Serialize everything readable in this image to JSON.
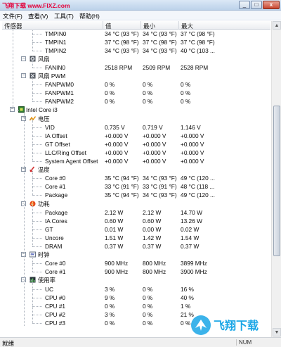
{
  "window": {
    "title": "飞翔下载 www.FIXZ.com"
  },
  "menu": [
    "文件(F)",
    "查看(V)",
    "工具(T)",
    "帮助(H)"
  ],
  "columns": {
    "sensor": "传感器",
    "value": "值",
    "min": "最小",
    "max": "最大"
  },
  "tree": [
    {
      "kind": "leaf",
      "label": "TMPIN0",
      "vals": [
        "34 °C  (93 °F)",
        "34 °C  (93 °F)",
        "37 °C  (98 °F)"
      ]
    },
    {
      "kind": "leaf",
      "label": "TMPIN1",
      "vals": [
        "37 °C  (98 °F)",
        "37 °C  (98 °F)",
        "37 °C  (98 °F)"
      ]
    },
    {
      "kind": "leaf",
      "label": "TMPIN2",
      "vals": [
        "34 °C  (93 °F)",
        "34 °C  (93 °F)",
        "40 °C  (103 ..."
      ]
    },
    {
      "kind": "cat",
      "label": "风扇",
      "icon": "fan-icon"
    },
    {
      "kind": "leaf",
      "label": "FANIN0",
      "vals": [
        "2518 RPM",
        "2509 RPM",
        "2528 RPM"
      ]
    },
    {
      "kind": "cat",
      "label": "风扇 PWM",
      "icon": "fan-pwm-icon"
    },
    {
      "kind": "leaf",
      "label": "FANPWM0",
      "vals": [
        "0 %",
        "0 %",
        "0 %"
      ]
    },
    {
      "kind": "leaf",
      "label": "FANPWM1",
      "vals": [
        "0 %",
        "0 %",
        "0 %"
      ]
    },
    {
      "kind": "leaf",
      "label": "FANPWM2",
      "vals": [
        "0 %",
        "0 %",
        "0 %"
      ]
    },
    {
      "kind": "dev",
      "label": "Intel Core i3",
      "icon": "cpu-chip-icon"
    },
    {
      "kind": "cat",
      "label": "电压",
      "icon": "voltage-icon"
    },
    {
      "kind": "leaf",
      "label": "VID",
      "vals": [
        "0.735 V",
        "0.719 V",
        "1.146 V"
      ]
    },
    {
      "kind": "leaf",
      "label": "IA Offset",
      "vals": [
        "+0.000 V",
        "+0.000 V",
        "+0.000 V"
      ]
    },
    {
      "kind": "leaf",
      "label": "GT Offset",
      "vals": [
        "+0.000 V",
        "+0.000 V",
        "+0.000 V"
      ]
    },
    {
      "kind": "leaf",
      "label": "LLC/Ring Offset",
      "vals": [
        "+0.000 V",
        "+0.000 V",
        "+0.000 V"
      ]
    },
    {
      "kind": "leaf",
      "label": "System Agent Offset",
      "vals": [
        "+0.000 V",
        "+0.000 V",
        "+0.000 V"
      ]
    },
    {
      "kind": "cat",
      "label": "温度",
      "icon": "thermometer-icon"
    },
    {
      "kind": "leaf",
      "label": "Core #0",
      "vals": [
        "35 °C  (94 °F)",
        "34 °C  (93 °F)",
        "49 °C  (120 ..."
      ]
    },
    {
      "kind": "leaf",
      "label": "Core #1",
      "vals": [
        "33 °C  (91 °F)",
        "33 °C  (91 °F)",
        "48 °C  (118 ..."
      ]
    },
    {
      "kind": "leaf",
      "label": "Package",
      "vals": [
        "35 °C  (94 °F)",
        "34 °C  (93 °F)",
        "49 °C  (120 ..."
      ]
    },
    {
      "kind": "cat",
      "label": "功耗",
      "icon": "power-icon"
    },
    {
      "kind": "leaf",
      "label": "Package",
      "vals": [
        "2.12 W",
        "2.12 W",
        "14.70 W"
      ]
    },
    {
      "kind": "leaf",
      "label": "IA Cores",
      "vals": [
        "0.60 W",
        "0.60 W",
        "13.26 W"
      ]
    },
    {
      "kind": "leaf",
      "label": "GT",
      "vals": [
        "0.01 W",
        "0.00 W",
        "0.02 W"
      ]
    },
    {
      "kind": "leaf",
      "label": "Uncore",
      "vals": [
        "1.51 W",
        "1.42 W",
        "1.54 W"
      ]
    },
    {
      "kind": "leaf",
      "label": "DRAM",
      "vals": [
        "0.37 W",
        "0.37 W",
        "0.37 W"
      ]
    },
    {
      "kind": "cat",
      "label": "时钟",
      "icon": "clock-icon"
    },
    {
      "kind": "leaf",
      "label": "Core #0",
      "vals": [
        "900 MHz",
        "800 MHz",
        "3899 MHz"
      ]
    },
    {
      "kind": "leaf",
      "label": "Core #1",
      "vals": [
        "900 MHz",
        "800 MHz",
        "3900 MHz"
      ]
    },
    {
      "kind": "cat",
      "label": "使用率",
      "icon": "utilization-icon"
    },
    {
      "kind": "leaf",
      "label": "UC",
      "vals": [
        "3 %",
        "0 %",
        "16 %"
      ]
    },
    {
      "kind": "leaf",
      "label": "CPU #0",
      "vals": [
        "9 %",
        "0 %",
        "40 %"
      ]
    },
    {
      "kind": "leaf",
      "label": "CPU #1",
      "vals": [
        "0 %",
        "0 %",
        "1 %"
      ]
    },
    {
      "kind": "leaf",
      "label": "CPU #2",
      "vals": [
        "3 %",
        "0 %",
        "21 %"
      ]
    },
    {
      "kind": "leaf",
      "label": "CPU #3",
      "vals": [
        "0 %",
        "0 %",
        "0 %"
      ]
    }
  ],
  "status": {
    "left": "就绪",
    "right": "NUM"
  },
  "watermark": {
    "text": "飞翔下载"
  },
  "colors": {
    "title_text": "#e4003a",
    "watermark": "#1aa6e6"
  }
}
